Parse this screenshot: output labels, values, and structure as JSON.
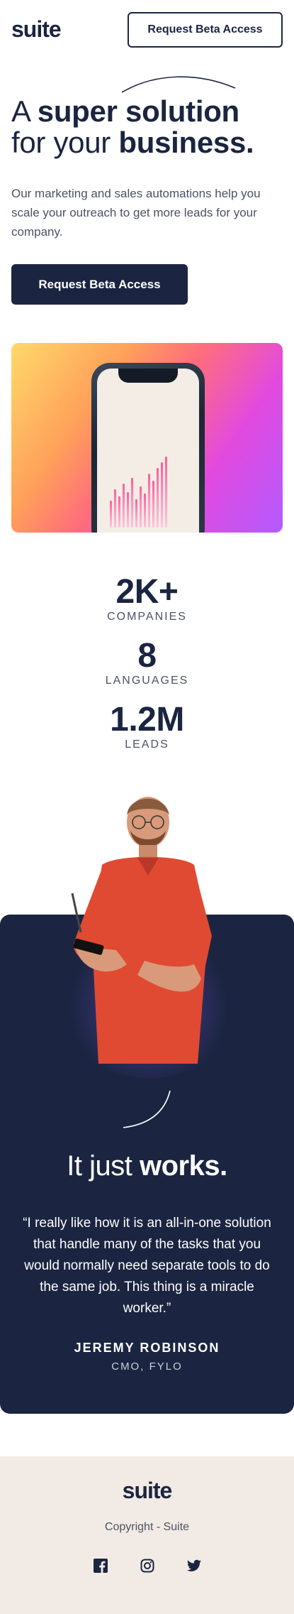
{
  "header": {
    "logo": "suite",
    "cta_label": "Request Beta Access"
  },
  "hero": {
    "title_parts": [
      "A ",
      "super solution",
      " for your ",
      "business."
    ],
    "text": "Our marketing and sales automations help you scale your outreach to get more leads for your company.",
    "cta_label": "Request Beta Access"
  },
  "stats": [
    {
      "value": "2K+",
      "label": "COMPANIES"
    },
    {
      "value": "8",
      "label": "LANGUAGES"
    },
    {
      "value": "1.2M",
      "label": "LEADS"
    }
  ],
  "testimonial": {
    "title_light": "It just ",
    "title_bold": "works.",
    "quote": "“I really like how it is an all-in-one solution that handle many of the tasks that you would normally need separate tools to do the same job. This thing is a miracle worker.”",
    "name": "JEREMY ROBINSON",
    "role": "CMO, FYLO"
  },
  "footer": {
    "logo": "suite",
    "copyright": "Copyright - Suite",
    "social_icons": [
      "facebook-icon",
      "instagram-icon",
      "twitter-icon"
    ]
  },
  "colors": {
    "navy": "#1b2541",
    "body_text": "#4b5264",
    "footer_bg": "#f2ebe5"
  }
}
